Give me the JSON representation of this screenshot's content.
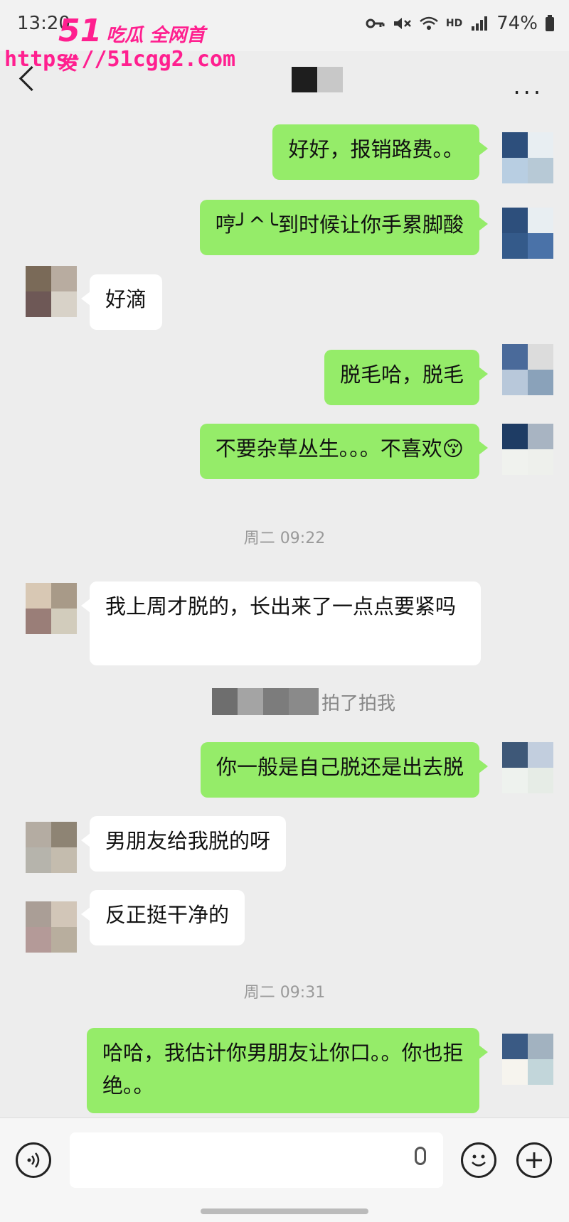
{
  "status_bar": {
    "time": "13:20",
    "battery": "74%",
    "network_label": "HD"
  },
  "watermark": {
    "number": "51",
    "tagline": "吃瓜 全网首发",
    "url": "https://51cgg2.com"
  },
  "header": {
    "more_label": "..."
  },
  "messages": [
    {
      "side": "out",
      "text": "好好，报销路费。。"
    },
    {
      "side": "out",
      "text": "哼╯^╰到时候让你手累脚酸"
    },
    {
      "side": "in",
      "text": "好滴"
    },
    {
      "side": "out",
      "text": "脱毛哈，脱毛"
    },
    {
      "side": "out",
      "text": "不要杂草丛生。。。不喜欢😚"
    },
    {
      "side": "in",
      "text": "我上周才脱的，长出来了一点点要紧吗"
    },
    {
      "side": "out",
      "text": "你一般是自己脱还是出去脱"
    },
    {
      "side": "in",
      "text": "男朋友给我脱的呀"
    },
    {
      "side": "in",
      "text": "反正挺干净的"
    },
    {
      "side": "out",
      "text": "哈哈，我估计你男朋友让你口。。你也拒绝。。"
    }
  ],
  "timestamps": [
    "周二 09:22",
    "周二 09:31"
  ],
  "system_notice": {
    "text": "拍了拍我"
  },
  "colors": {
    "outgoing_bubble": "#95ec69",
    "incoming_bubble": "#ffffff",
    "background": "#ededed",
    "watermark": "#ff1f8f"
  },
  "icons": {
    "voice": "voice-input-icon",
    "mic": "microphone-icon",
    "emoji": "emoji-icon",
    "plus": "plus-icon",
    "back": "back-chevron-icon",
    "more": "more-dots-icon"
  }
}
